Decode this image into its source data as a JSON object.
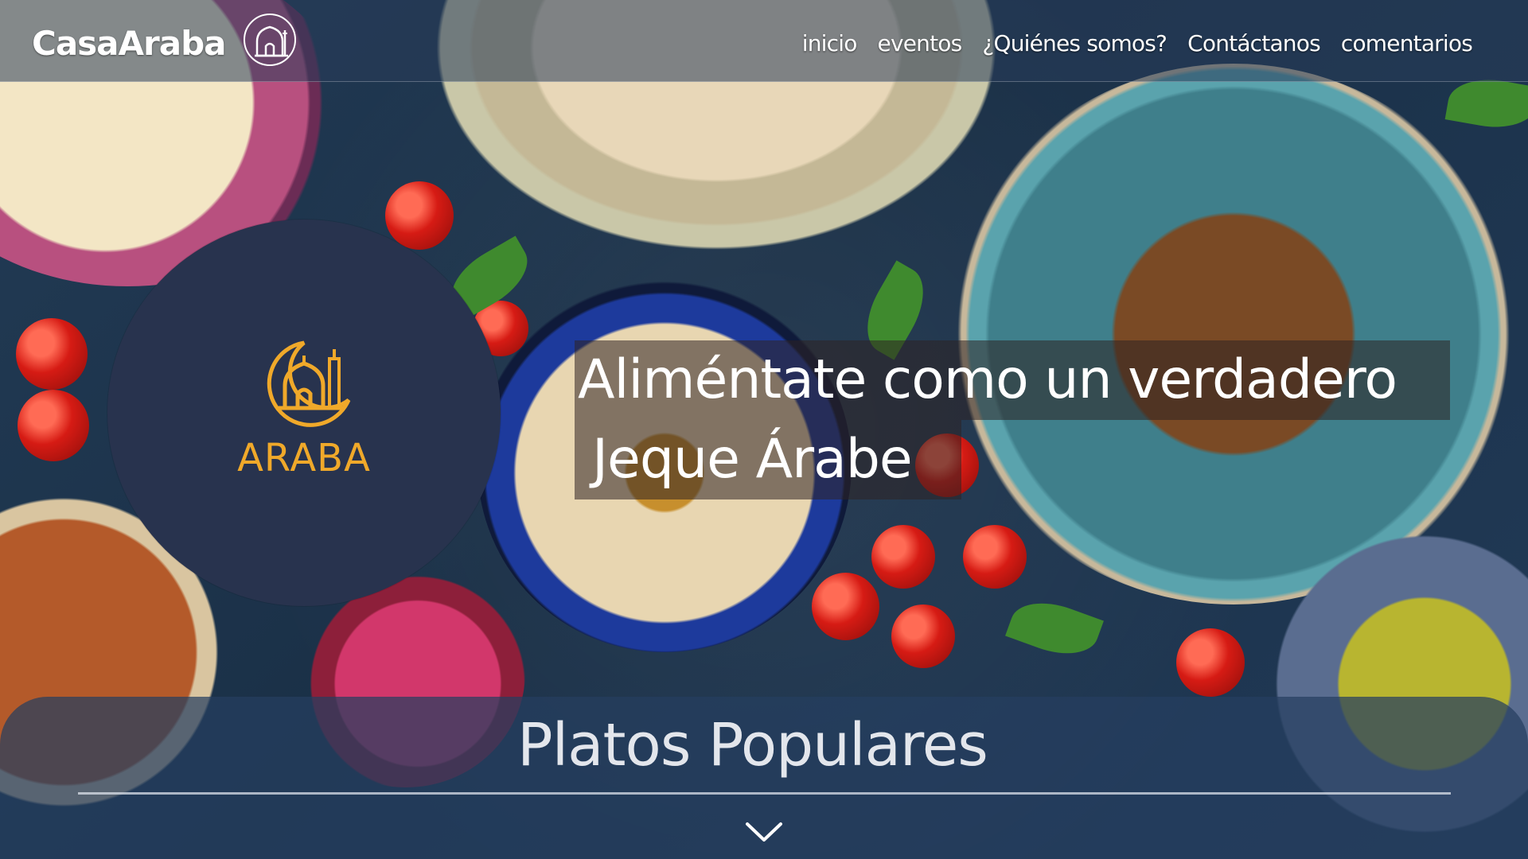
{
  "navbar": {
    "brand": "CasaAraba",
    "brand_icon": "mosque-icon",
    "links": [
      "inicio",
      "eventos",
      "¿Quiénes somos?",
      "Contáctanos",
      "comentarios"
    ]
  },
  "logo": {
    "label": "ARABA",
    "icon": "mosque-crescent-icon",
    "color": "#f0a92a",
    "background": "#28334e"
  },
  "hero": {
    "line1": "Aliméntate como un verdadero",
    "line2": "Jeque Árabe"
  },
  "section": {
    "title": "Platos Populares",
    "scroll_icon": "chevron-down-icon"
  }
}
